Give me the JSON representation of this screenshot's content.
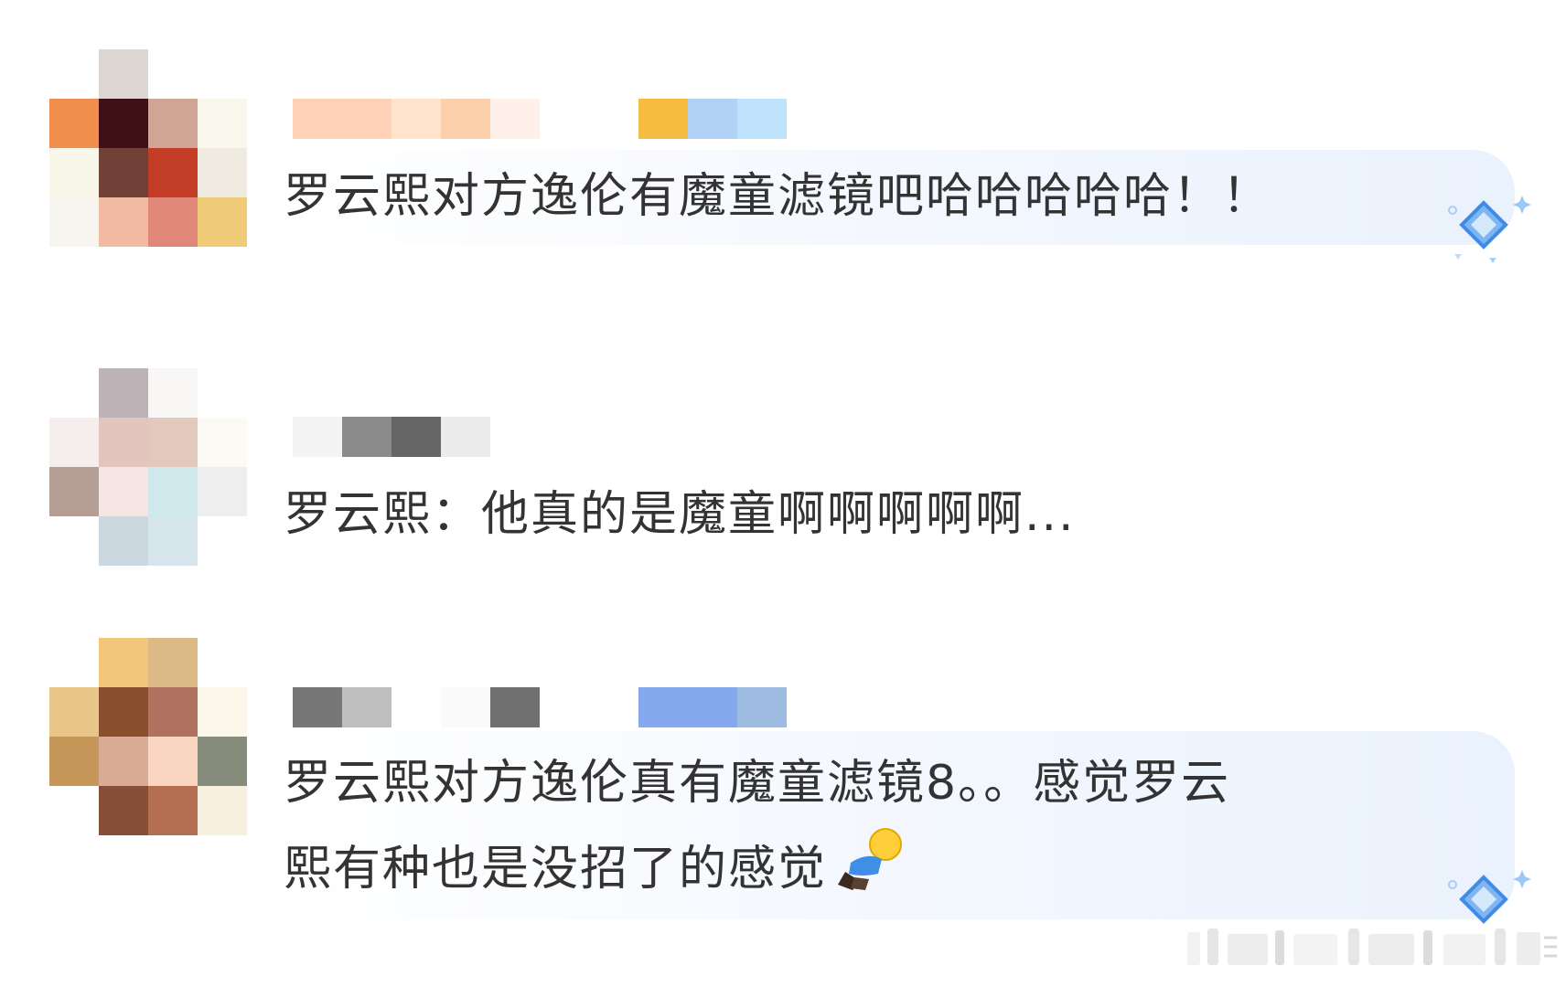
{
  "comments": [
    {
      "avatar_tiles": [
        "#dcd7d3",
        "#f18e4e",
        "#3f1016",
        "#d1a596",
        "#f8f7ec",
        "#f8f6e8",
        "#6f4137",
        "#c23c26",
        "#efebe1",
        "#f6f5f0",
        "#f2b9a3",
        "#e0877a",
        "#f0cb78"
      ],
      "username_blocks": [
        "#ffd2b8",
        "#ffe3cd",
        "#fff3ea",
        "#fdd0ac",
        "#fff0e9",
        "#f6bc42",
        "#b2d2f5",
        "#bfe2fd"
      ],
      "text": "罗云熙对方逸伦有魔童滤镜吧哈哈哈哈哈！！",
      "badge_icon": "diamond-badge-icon"
    },
    {
      "avatar_tiles": [
        "#bdb3b7",
        "#f8f7f6",
        "#f6eeec",
        "#e3c5be",
        "#e3c9bd",
        "#fbfaf5",
        "#b59e94",
        "#f6e6e3",
        "#cfe8ec",
        "#eeeeee",
        "#cbd8e0",
        "#d7e5ec"
      ],
      "username_blocks": [
        "#f4f4f4",
        "#8b8b8b",
        "#666666",
        "#ececec"
      ],
      "text": "罗云熙：他真的是魔童啊啊啊啊啊..."
    },
    {
      "avatar_tiles": [
        "#f2c678",
        "#dcba86",
        "#e8c589",
        "#8a4f2d",
        "#b0715f",
        "#fbf7ea",
        "#c59859",
        "#d9ab94",
        "#fad6c2",
        "#868b7b",
        "#874f38",
        "#b46f52",
        "#f7f0df"
      ],
      "username_blocks": [
        "#777777",
        "#bfbfbf",
        "#fafafa",
        "#707070",
        "#85a9ef",
        "#9fbde2"
      ],
      "text": "罗云熙对方逸伦真有魔童滤镜8。。感觉罗云\n熙有种也是没招了的感觉",
      "emoji_icon": "lying-figure-emoji-icon",
      "badge_icon": "diamond-badge-icon"
    }
  ],
  "watermark": {
    "bar_colors": [
      "#f2f2f2",
      "#e6e6e6",
      "#ededed",
      "#dcdcdc",
      "#f4f4f4"
    ],
    "icon": "weibo-watermark-icon"
  }
}
